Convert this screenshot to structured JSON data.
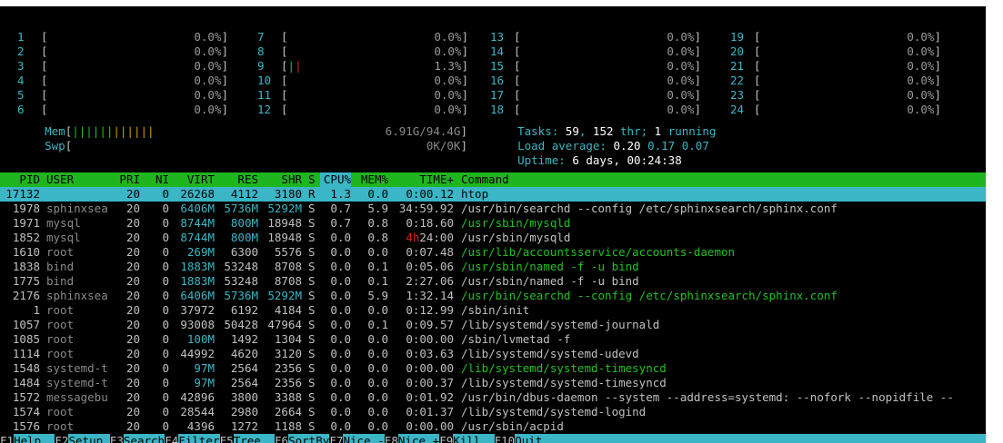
{
  "cpus": [
    {
      "id": "1",
      "pct": "0.0%"
    },
    {
      "id": "2",
      "pct": "0.0%"
    },
    {
      "id": "3",
      "pct": "0.0%"
    },
    {
      "id": "4",
      "pct": "0.0%"
    },
    {
      "id": "5",
      "pct": "0.0%"
    },
    {
      "id": "6",
      "pct": "0.0%"
    },
    {
      "id": "7",
      "pct": "0.0%"
    },
    {
      "id": "8",
      "pct": "0.0%"
    },
    {
      "id": "9",
      "pct": "1.3%",
      "bar": "||"
    },
    {
      "id": "10",
      "pct": "0.0%"
    },
    {
      "id": "11",
      "pct": "0.0%"
    },
    {
      "id": "12",
      "pct": "0.0%"
    },
    {
      "id": "13",
      "pct": "0.0%"
    },
    {
      "id": "14",
      "pct": "0.0%"
    },
    {
      "id": "15",
      "pct": "0.0%"
    },
    {
      "id": "16",
      "pct": "0.0%"
    },
    {
      "id": "17",
      "pct": "0.0%"
    },
    {
      "id": "18",
      "pct": "0.0%"
    },
    {
      "id": "19",
      "pct": "0.0%"
    },
    {
      "id": "20",
      "pct": "0.0%"
    },
    {
      "id": "21",
      "pct": "0.0%"
    },
    {
      "id": "22",
      "pct": "0.0%"
    },
    {
      "id": "23",
      "pct": "0.0%"
    },
    {
      "id": "24",
      "pct": "0.0%"
    }
  ],
  "mem": {
    "label": "Mem",
    "bar_green": "||||||",
    "bar_yellow": "||||||",
    "value": "6.91G/94.4G"
  },
  "swp": {
    "label": "Swp",
    "value": "0K/0K"
  },
  "stats": {
    "tasks_label": "Tasks: ",
    "tasks": "59",
    "thr_sep": ", ",
    "thr": "152",
    "thr_label": " thr; ",
    "running": "1",
    "running_label": " running",
    "load_label": "Load average: ",
    "load1": "0.20",
    "load5": "0.17",
    "load15": "0.07",
    "uptime_label": "Uptime: ",
    "uptime": "6 days, 00:24:38"
  },
  "columns": {
    "pid": "PID",
    "user": "USER",
    "pri": "PRI",
    "ni": "NI",
    "virt": "VIRT",
    "res": "RES",
    "shr": "SHR",
    "s": "S",
    "cpu": "CPU%",
    "mem": "MEM%",
    "time": "TIME+",
    "cmd": "Command"
  },
  "processes": [
    {
      "pid": "17132",
      "user": "",
      "pri": "20",
      "ni": "0",
      "virt": "26268",
      "res": "4112",
      "shr": "3180",
      "s": "R",
      "cpu": "1.3",
      "mem": "0.0",
      "time": "0:00.12",
      "cmd": "htop",
      "selected": true
    },
    {
      "pid": "1978",
      "user": "sphinxsea",
      "pri": "20",
      "ni": "0",
      "virt": "6406M",
      "res": "5736M",
      "shr": "5292M",
      "s": "S",
      "cpu": "0.7",
      "mem": "5.9",
      "time": "34:59.92",
      "cmd": "/usr/bin/searchd --config /etc/sphinxsearch/sphinx.conf",
      "cmdColor": "gray"
    },
    {
      "pid": "1971",
      "user": "mysql",
      "pri": "20",
      "ni": "0",
      "virt": "8744M",
      "res": "800M",
      "shr": "18948",
      "s": "S",
      "cpu": "0.7",
      "mem": "0.8",
      "time": "0:18.60",
      "cmd": "/usr/sbin/mysqld",
      "cmdColor": "green"
    },
    {
      "pid": "1852",
      "user": "mysql",
      "pri": "20",
      "ni": "0",
      "virt": "8744M",
      "res": "800M",
      "shr": "18948",
      "s": "S",
      "cpu": "0.0",
      "mem": "0.8",
      "time": "4h24:00",
      "cmd": "/usr/sbin/mysqld",
      "timeRed": "4h"
    },
    {
      "pid": "1610",
      "user": "root",
      "pri": "20",
      "ni": "0",
      "virt": "269M",
      "res": "6300",
      "shr": "5576",
      "s": "S",
      "cpu": "0.0",
      "mem": "0.0",
      "time": "0:07.48",
      "cmd": "/usr/lib/accountsservice/accounts-daemon",
      "cmdColor": "green"
    },
    {
      "pid": "1838",
      "user": "bind",
      "pri": "20",
      "ni": "0",
      "virt": "1883M",
      "res": "53248",
      "shr": "8708",
      "s": "S",
      "cpu": "0.0",
      "mem": "0.1",
      "time": "0:05.06",
      "cmd": "/usr/sbin/named -f -u bind",
      "cmdColor": "green"
    },
    {
      "pid": "1775",
      "user": "bind",
      "pri": "20",
      "ni": "0",
      "virt": "1883M",
      "res": "53248",
      "shr": "8708",
      "s": "S",
      "cpu": "0.0",
      "mem": "0.1",
      "time": "2:27.06",
      "cmd": "/usr/sbin/named -f -u bind"
    },
    {
      "pid": "2176",
      "user": "sphinxsea",
      "pri": "20",
      "ni": "0",
      "virt": "6406M",
      "res": "5736M",
      "shr": "5292M",
      "s": "S",
      "cpu": "0.0",
      "mem": "5.9",
      "time": "1:32.14",
      "cmd": "/usr/bin/searchd --config /etc/sphinxsearch/sphinx.conf",
      "cmdColor": "green"
    },
    {
      "pid": "1",
      "user": "root",
      "pri": "20",
      "ni": "0",
      "virt": "37972",
      "res": "6192",
      "shr": "4184",
      "s": "S",
      "cpu": "0.0",
      "mem": "0.0",
      "time": "0:12.99",
      "cmd": "/sbin/init"
    },
    {
      "pid": "1057",
      "user": "root",
      "pri": "20",
      "ni": "0",
      "virt": "93008",
      "res": "50428",
      "shr": "47964",
      "s": "S",
      "cpu": "0.0",
      "mem": "0.1",
      "time": "0:09.57",
      "cmd": "/lib/systemd/systemd-journald"
    },
    {
      "pid": "1085",
      "user": "root",
      "pri": "20",
      "ni": "0",
      "virt": "100M",
      "res": "1492",
      "shr": "1304",
      "s": "S",
      "cpu": "0.0",
      "mem": "0.0",
      "time": "0:00.00",
      "cmd": "/sbin/lvmetad -f"
    },
    {
      "pid": "1114",
      "user": "root",
      "pri": "20",
      "ni": "0",
      "virt": "44992",
      "res": "4620",
      "shr": "3120",
      "s": "S",
      "cpu": "0.0",
      "mem": "0.0",
      "time": "0:03.63",
      "cmd": "/lib/systemd/systemd-udevd"
    },
    {
      "pid": "1548",
      "user": "systemd-t",
      "pri": "20",
      "ni": "0",
      "virt": "97M",
      "res": "2564",
      "shr": "2356",
      "s": "S",
      "cpu": "0.0",
      "mem": "0.0",
      "time": "0:00.00",
      "cmd": "/lib/systemd/systemd-timesyncd",
      "cmdColor": "green"
    },
    {
      "pid": "1484",
      "user": "systemd-t",
      "pri": "20",
      "ni": "0",
      "virt": "97M",
      "res": "2564",
      "shr": "2356",
      "s": "S",
      "cpu": "0.0",
      "mem": "0.0",
      "time": "0:00.37",
      "cmd": "/lib/systemd/systemd-timesyncd"
    },
    {
      "pid": "1572",
      "user": "messagebu",
      "pri": "20",
      "ni": "0",
      "virt": "42896",
      "res": "3800",
      "shr": "3388",
      "s": "S",
      "cpu": "0.0",
      "mem": "0.0",
      "time": "0:01.92",
      "cmd": "/usr/bin/dbus-daemon --system --address=systemd: --nofork --nopidfile --"
    },
    {
      "pid": "1574",
      "user": "root",
      "pri": "20",
      "ni": "0",
      "virt": "28544",
      "res": "2980",
      "shr": "2664",
      "s": "S",
      "cpu": "0.0",
      "mem": "0.0",
      "time": "0:01.37",
      "cmd": "/lib/systemd/systemd-logind"
    },
    {
      "pid": "1576",
      "user": "root",
      "pri": "20",
      "ni": "0",
      "virt": "4396",
      "res": "1272",
      "shr": "1188",
      "s": "S",
      "cpu": "0.0",
      "mem": "0.0",
      "time": "0:00.00",
      "cmd": "/usr/sbin/acpid"
    }
  ],
  "footer": [
    {
      "key": "F1",
      "label": "Help"
    },
    {
      "key": "F2",
      "label": "Setup"
    },
    {
      "key": "F3",
      "label": "Search"
    },
    {
      "key": "F4",
      "label": "Filter"
    },
    {
      "key": "F5",
      "label": "Tree"
    },
    {
      "key": "F6",
      "label": "SortBy"
    },
    {
      "key": "F7",
      "label": "Nice -"
    },
    {
      "key": "F8",
      "label": "Nice +"
    },
    {
      "key": "F9",
      "label": "Kill"
    },
    {
      "key": "F10",
      "label": "Quit"
    }
  ],
  "colors": {
    "cyan": "#3ab6c6",
    "green": "#1fb51f",
    "red": "#d02020",
    "yellow": "#c8a000"
  }
}
